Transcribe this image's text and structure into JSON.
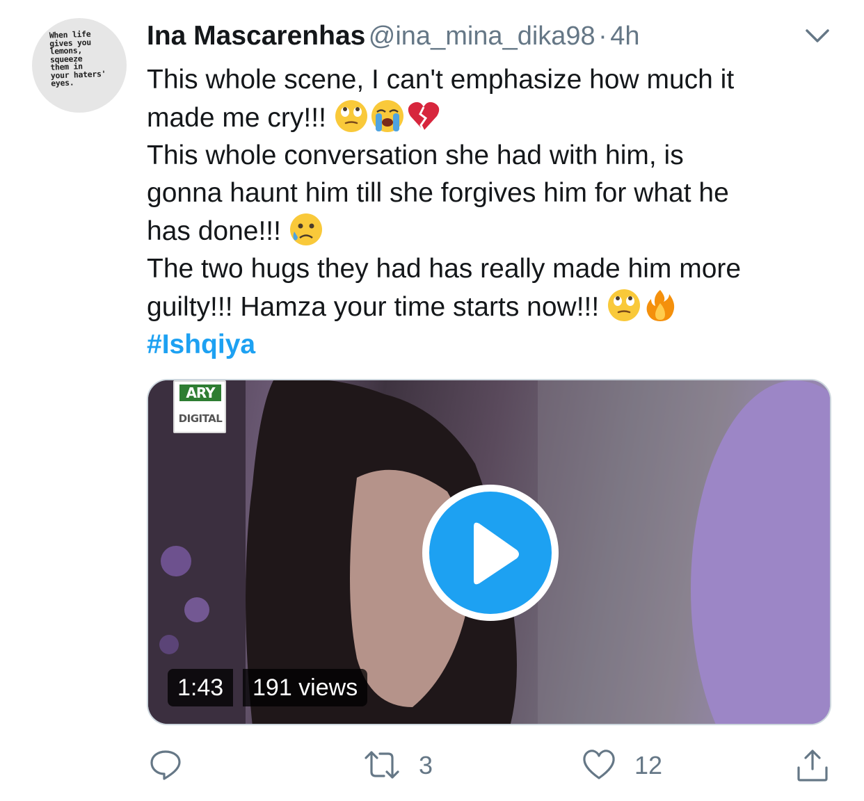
{
  "avatar": {
    "text": "When life\ngives you\nlemons,\nsqueeze\nthem in\nyour haters'\neyes."
  },
  "tweet": {
    "display_name": "Ina Mascarenhas",
    "handle": "@ina_mina_dika98",
    "separator": "·",
    "time": "4h",
    "lines": [
      "This whole scene, I can't emphasize how much it",
      "made me cry!!! ",
      "This whole conversation she had with him, is",
      "gonna haunt him till she forgives him for what he",
      "has done!!! ",
      "The two hugs they had has really made him more",
      "guilty!!! Hamza your time starts now!!! "
    ],
    "hashtag": "#Ishqiya"
  },
  "media": {
    "logo_top": "ARY",
    "logo_bottom": "DIGITAL",
    "duration": "1:43",
    "views": "191 views"
  },
  "actions": {
    "retweets": "3",
    "likes": "12"
  },
  "colors": {
    "accent": "#1da1f2",
    "muted": "#657786"
  },
  "icons": [
    "chevron-down-icon",
    "eye-roll-emoji",
    "crying-emoji",
    "broken-heart-emoji",
    "sad-tear-emoji",
    "fire-emoji",
    "play-icon",
    "reply-icon",
    "retweet-icon",
    "like-icon",
    "share-icon"
  ]
}
